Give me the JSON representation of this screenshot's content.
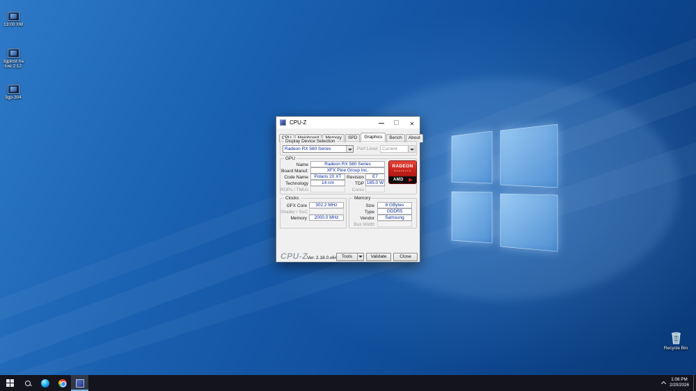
{
  "colors": {
    "accent_blue": "#0078d7",
    "field_value_text": "#0a2a9c",
    "badge_red": "#c4201a",
    "taskbar_bg": "#14141d",
    "wallpaper_blue": "#11509e"
  },
  "icon_glyphs": {
    "close": "✕"
  },
  "desktop": {
    "icons": [
      {
        "label": "13:00 XM"
      },
      {
        "label": "3gplost ha low 2:12"
      },
      {
        "label": "3gp-304"
      }
    ],
    "recycle_bin_label": "Recycle Bin"
  },
  "cpuz": {
    "title": "CPU-Z",
    "tabs": [
      {
        "label": "CPU"
      },
      {
        "label": "Mainboard"
      },
      {
        "label": "Memory"
      },
      {
        "label": "SPD"
      },
      {
        "label": "Graphics"
      },
      {
        "label": "Bench"
      },
      {
        "label": "About"
      }
    ],
    "active_tab": "Graphics",
    "display_selection": {
      "group_label": "Display Device Selection",
      "device_value": "Radeon RX 580 Series",
      "perf_label": "Perf Level",
      "perf_value": "Current"
    },
    "gpu": {
      "group_label": "GPU",
      "name_label": "Name",
      "name_value": "Radeon RX 580 Series",
      "board_label": "Board Manuf.",
      "board_value": "XFX Pine Group Inc.",
      "code_label": "Code Name",
      "code_value": "Polaris 20 XT",
      "revision_label": "Revision",
      "revision_value": "E7",
      "tech_label": "Technology",
      "tech_value": "14 nm",
      "tdp_label": "TDP",
      "tdp_value": "185.0 W",
      "rops_label": "ROPs / TMUs",
      "rops_value": "",
      "cores_label": "Cores",
      "cores_value": "",
      "badge": {
        "line1": "RADEON",
        "line2": "GRAPHICS",
        "brand": "AMD"
      }
    },
    "clocks": {
      "group_label": "Clocks",
      "gfx_label": "GFX Core",
      "gfx_value": "302.2 MHz",
      "shader_label": "Shader / SoC",
      "shader_value": "",
      "memory_label": "Memory",
      "memory_value": "2000.0 MHz"
    },
    "memory": {
      "group_label": "Memory",
      "size_label": "Size",
      "size_value": "8 GBytes",
      "type_label": "Type",
      "type_value": "GDDR5",
      "vendor_label": "Vendor",
      "vendor_value": "Samsung",
      "bus_label": "Bus Width",
      "bus_value": ""
    },
    "footer": {
      "logo": "CPU-Z",
      "version": "Ver. 2.18.0.x64",
      "tools_label": "Tools",
      "validate_label": "Validate",
      "close_label": "Close"
    }
  },
  "taskbar": {
    "clock": {
      "time": "1:08 PM",
      "date": "2/20/2026"
    }
  }
}
